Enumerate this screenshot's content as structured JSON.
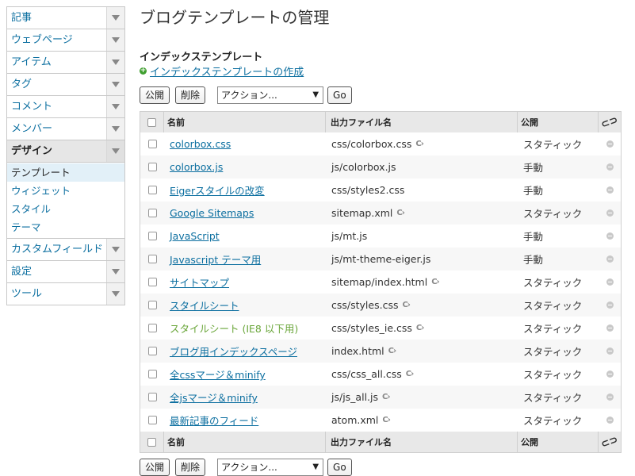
{
  "sidebar": {
    "items": [
      {
        "label": "記事"
      },
      {
        "label": "ウェブページ"
      },
      {
        "label": "アイテム"
      },
      {
        "label": "タグ"
      },
      {
        "label": "コメント"
      },
      {
        "label": "メンバー"
      },
      {
        "label": "デザイン"
      },
      {
        "label": "カスタムフィールド"
      },
      {
        "label": "設定"
      },
      {
        "label": "ツール"
      }
    ],
    "design_sub": [
      {
        "label": "テンプレート"
      },
      {
        "label": "ウィジェット"
      },
      {
        "label": "スタイル"
      },
      {
        "label": "テーマ"
      }
    ]
  },
  "page": {
    "title": "ブログテンプレートの管理",
    "section_title": "インデックステンプレート",
    "create_link": "インデックステンプレートの作成"
  },
  "actions": {
    "publish": "公開",
    "delete": "削除",
    "action_select": "アクション...",
    "go": "Go"
  },
  "table": {
    "headers": {
      "name": "名前",
      "file": "出力ファイル名",
      "publish": "公開"
    },
    "rows": [
      {
        "name": "colorbox.css",
        "file": "css/colorbox.css",
        "publish": "スタティック",
        "rebuild": true
      },
      {
        "name": "colorbox.js",
        "file": "js/colorbox.js",
        "publish": "手動",
        "rebuild": false
      },
      {
        "name": "Eigerスタイルの改変",
        "file": "css/styles2.css",
        "publish": "手動",
        "rebuild": false
      },
      {
        "name": "Google Sitemaps",
        "file": "sitemap.xml",
        "publish": "スタティック",
        "rebuild": true
      },
      {
        "name": "JavaScript",
        "file": "js/mt.js",
        "publish": "手動",
        "rebuild": false
      },
      {
        "name": "Javascript テーマ用",
        "file": "js/mt-theme-eiger.js",
        "publish": "手動",
        "rebuild": false
      },
      {
        "name": "サイトマップ",
        "file": "sitemap/index.html",
        "publish": "スタティック",
        "rebuild": true
      },
      {
        "name": "スタイルシート",
        "file": "css/styles.css",
        "publish": "スタティック",
        "rebuild": true
      },
      {
        "name": "スタイルシート (IE8 以下用)",
        "file": "css/styles_ie.css",
        "publish": "スタティック",
        "rebuild": true,
        "plain": true
      },
      {
        "name": "ブログ用インデックスページ",
        "file": "index.html",
        "publish": "スタティック",
        "rebuild": true
      },
      {
        "name": "全cssマージ＆minify",
        "file": "css/css_all.css",
        "publish": "スタティック",
        "rebuild": true
      },
      {
        "name": "全jsマージ＆minify",
        "file": "js/js_all.js",
        "publish": "スタティック",
        "rebuild": true
      },
      {
        "name": "最新記事のフィード",
        "file": "atom.xml",
        "publish": "スタティック",
        "rebuild": true
      }
    ]
  },
  "icons": {
    "sidebar_arrow": "chevron-down-icon",
    "create": "plus-circle-icon",
    "rebuild": "rebuild-icon",
    "status": "minus-circle-icon",
    "link": "link-icon"
  }
}
